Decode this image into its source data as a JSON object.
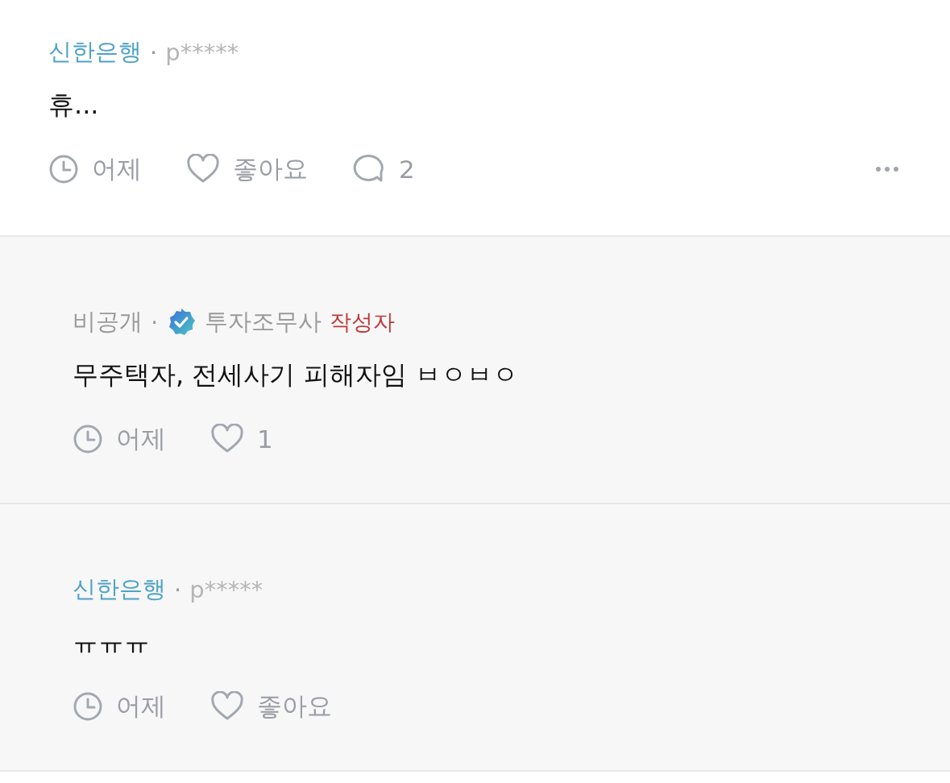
{
  "comment": {
    "bank": "신한은행",
    "separator": "·",
    "user": "p*****",
    "text": "휴...",
    "time": "어제",
    "like": "좋아요",
    "reply_count": "2"
  },
  "replies": [
    {
      "kind": "private",
      "name": "비공개",
      "separator": "·",
      "nickname": "투자조무사",
      "author_tag": "작성자",
      "text": "무주택자, 전세사기 피해자임 ㅂㅇㅂㅇ",
      "time": "어제",
      "like": "1"
    },
    {
      "kind": "bank",
      "name": "신한은행",
      "separator": "·",
      "user": "p*****",
      "text": "ㅠㅠㅠ",
      "time": "어제",
      "like": "좋아요"
    }
  ]
}
